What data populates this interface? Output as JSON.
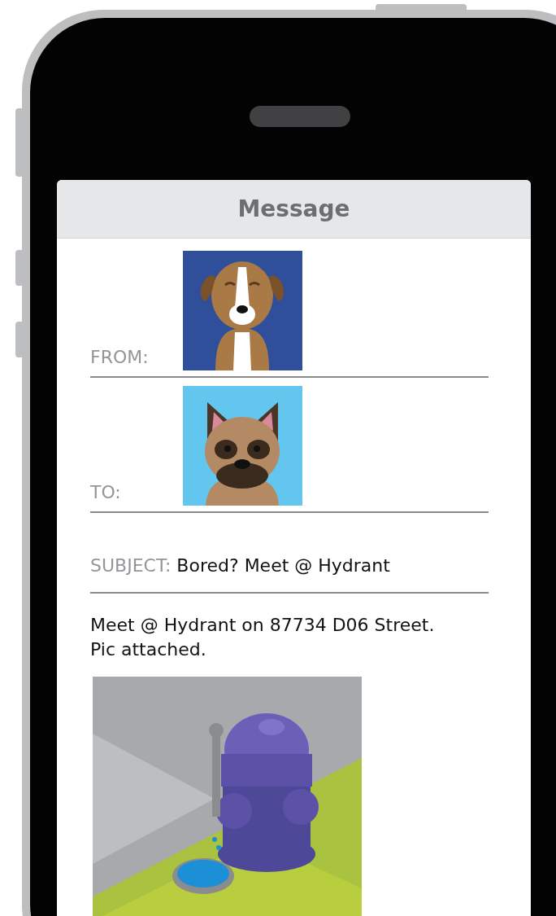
{
  "screen": {
    "title": "Message"
  },
  "from": {
    "label": "FROM:"
  },
  "to": {
    "label": "TO:"
  },
  "subject": {
    "label": "SUBJECT:",
    "value": "Bored? Meet @ Hydrant"
  },
  "body": "Meet @ Hydrant on 87734 D06 Street. Pic attached."
}
